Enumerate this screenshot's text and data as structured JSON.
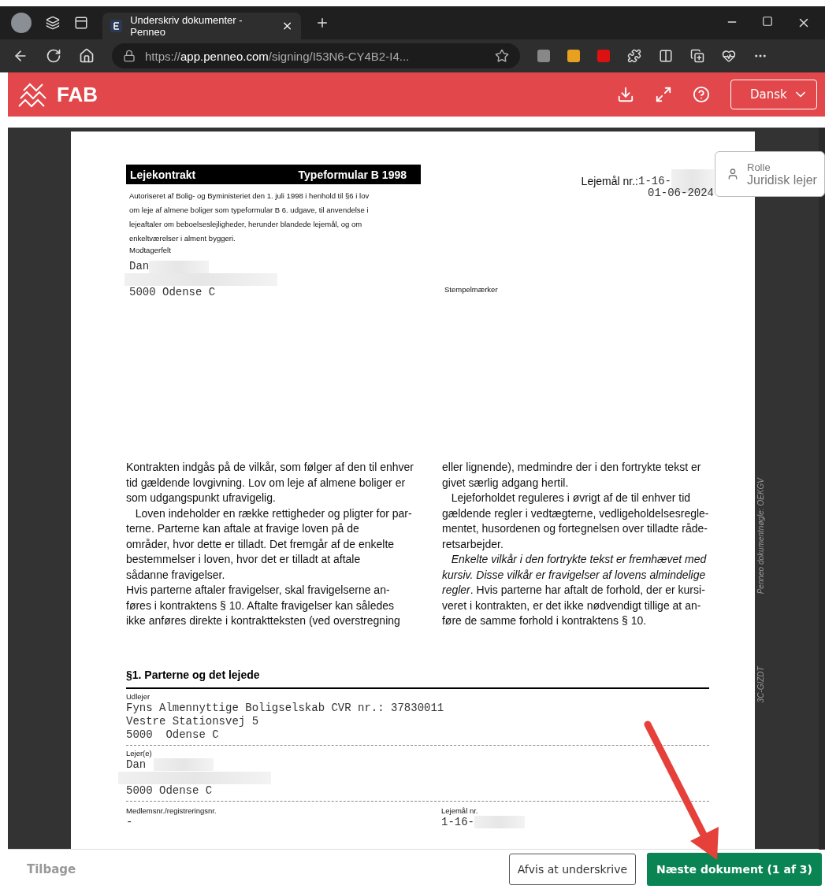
{
  "browser": {
    "tab_title": "Underskriv dokumenter - Penneo",
    "url_prefix": "https://",
    "url_domain": "app.penneo.com",
    "url_path": "/signing/I53N6-CY4B2-I4..."
  },
  "header": {
    "logo": "FAB",
    "language": "Dansk"
  },
  "role_popup": {
    "label": "Rolle",
    "value": "Juridisk lejer"
  },
  "document": {
    "title_left": "Lejekontrakt",
    "title_right": "Typeformular B 1998",
    "authorization": [
      "Autoriseret af Bolig- og Byministeriet den 1. juli 1998 i henhold til §6 i lov",
      "om leje af almene boliger som typeformular B 6. udgave, til anvendelse i",
      "lejeaftaler om beboelseslejligheder, herunder blandede lejemål, og om",
      "enkeltværelser i alment byggeri."
    ],
    "lease_label": "Lejemål nr.:",
    "lease_value": "1-16-",
    "date": "01-06-2024",
    "recipient_label": "Modtagerfelt",
    "recipient_name": "Dan",
    "recipient_city": "5000 Odense C",
    "stamp_label": "Stempelmærker",
    "col_left": [
      "Kontrakten indgås på de vilkår, som følger af den til enhver",
      "tid gældende lovgivning. Lov om leje af almene boliger er",
      "som udgangspunkt ufravigelig.",
      "   Loven indeholder en række rettigheder og pligter for par-",
      "terne. Parterne kan aftale at fravige loven på de",
      "områder, hvor dette er tilladt. Det fremgår af de enkelte",
      "bestemmelser i loven, hvor det er tilladt at aftale",
      "sådanne fravigelser.",
      "Hvis parterne aftaler fravigelser, skal fravigelserne an-",
      "føres i kontraktens § 10. Aftalte fravigelser kan således",
      "ikke anføres direkte i kontraktteksten (ved overstregning"
    ],
    "col_right": [
      "eller lignende), medmindre der i den fortrykte tekst er",
      "givet særlig adgang hertil.",
      "   Lejeforholdet reguleres i øvrigt af de til enhver tid",
      "gældende regler i vedtægterne, vedligeholdelsesregle-",
      "mentet, husordenen og fortegnelsen over tilladte råde-",
      "retsarbejder.",
      "   *Enkelte vilkår i den fortrykte tekst er fremhævet med*",
      "*kursiv. Disse vilkår er fravigelser af lovens almindelige*",
      "*regler*. Hvis parterne har aftalt de forhold, der er kursi-",
      "veret i kontrakten, er det ikke nødvendigt tillige at an-",
      "føre de samme forhold i kontraktens § 10."
    ],
    "section_title": "§1. Parterne og det lejede",
    "landlord_label": "Udlejer",
    "landlord_lines": [
      "Fyns Almennyttige Boligselskab CVR nr.: 37830011",
      "Vestre Stationsvej 5",
      "5000  Odense C"
    ],
    "tenant_label": "Lejer(e)",
    "tenant_name": "Dan",
    "tenant_city": "5000 Odense C",
    "member_label": "Medlemsnr./registreringsnr.",
    "member_value": "-",
    "lease2_label": "Lejemål nr.",
    "lease2_value": "1-16-",
    "side_key_start": "Penneo dokumentnøgle: OEKGV",
    "side_key_end": "3C-GIZDT"
  },
  "footer": {
    "back": "Tilbage",
    "reject": "Afvis at underskrive",
    "next": "Næste dokument (1 af 3)"
  }
}
